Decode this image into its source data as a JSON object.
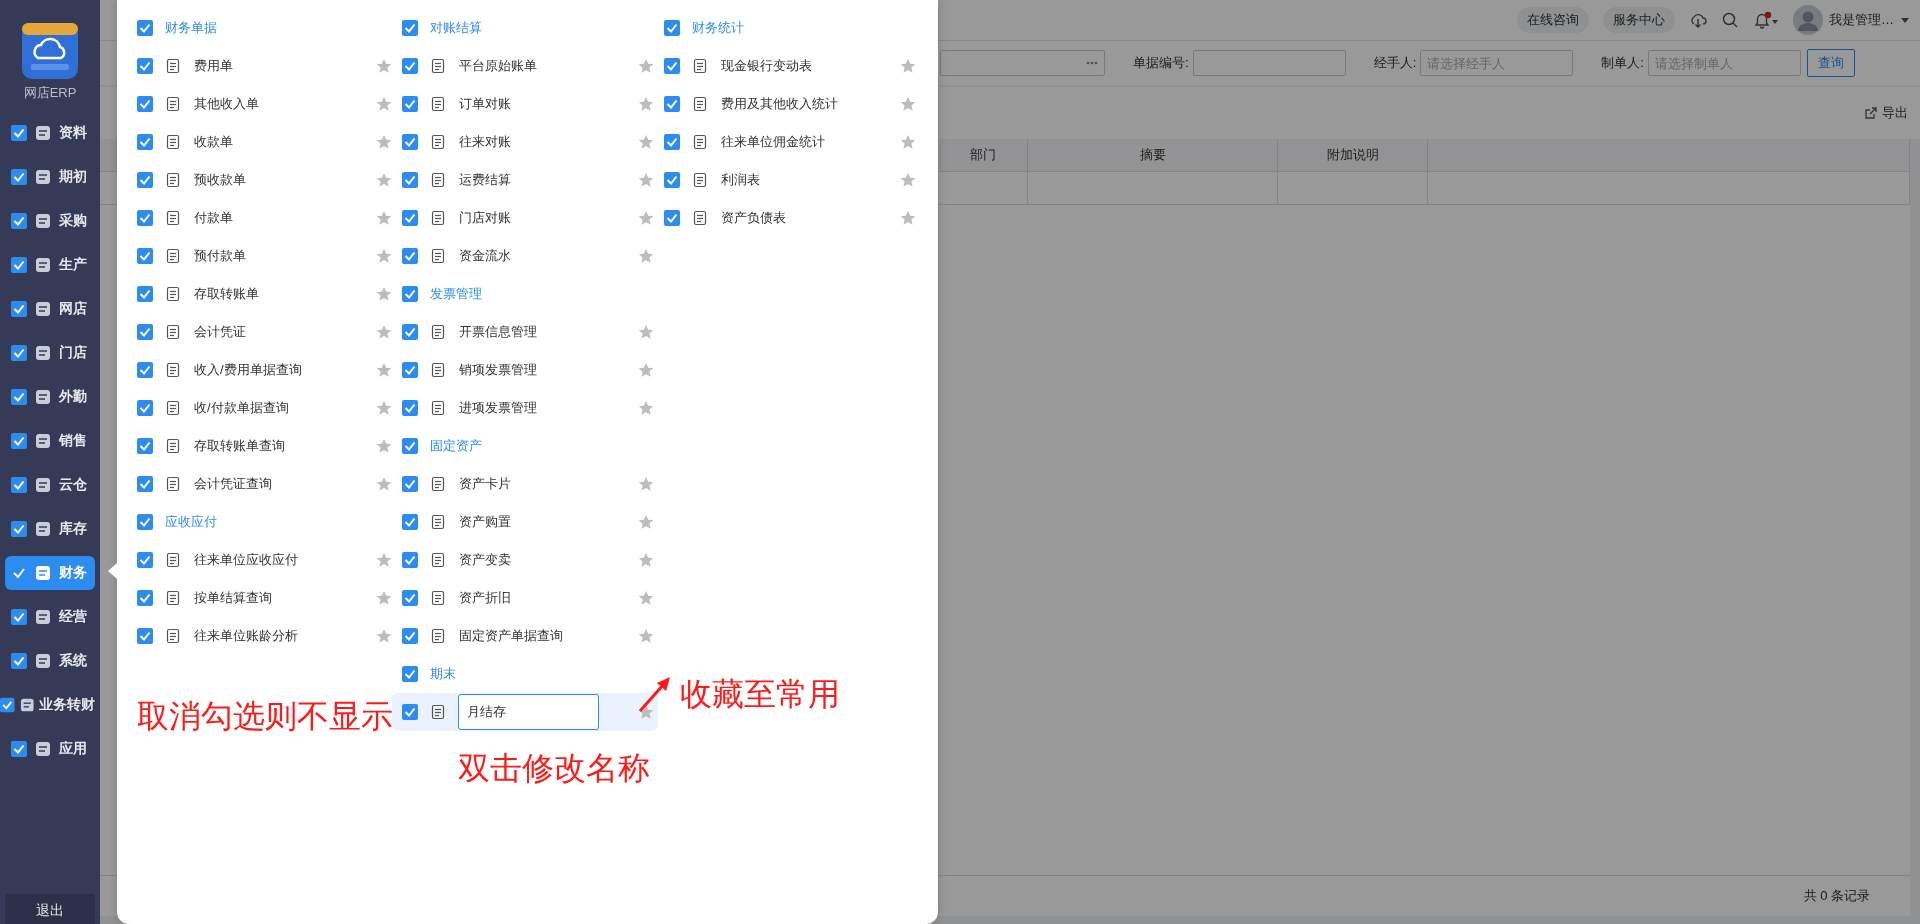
{
  "sidebar": {
    "app_name": "网店ERP",
    "items": [
      {
        "label": "资料",
        "checked": true,
        "selected": false
      },
      {
        "label": "期初",
        "checked": true,
        "selected": false
      },
      {
        "label": "采购",
        "checked": true,
        "selected": false
      },
      {
        "label": "生产",
        "checked": true,
        "selected": false
      },
      {
        "label": "网店",
        "checked": true,
        "selected": false
      },
      {
        "label": "门店",
        "checked": true,
        "selected": false
      },
      {
        "label": "外勤",
        "checked": true,
        "selected": false
      },
      {
        "label": "销售",
        "checked": true,
        "selected": false
      },
      {
        "label": "云仓",
        "checked": true,
        "selected": false
      },
      {
        "label": "库存",
        "checked": true,
        "selected": false
      },
      {
        "label": "财务",
        "checked": true,
        "selected": true
      },
      {
        "label": "经营",
        "checked": true,
        "selected": false
      },
      {
        "label": "系统",
        "checked": true,
        "selected": false
      },
      {
        "label": "业务转财",
        "checked": true,
        "selected": false
      },
      {
        "label": "应用",
        "checked": true,
        "selected": false
      }
    ],
    "logout": "退出"
  },
  "app": {
    "top_links": [
      "在线咨询",
      "服务中心"
    ],
    "has_alert": true,
    "user_name": "我是管理…",
    "filters": [
      {
        "label": "单据编号:"
      },
      {
        "label": "经手人:",
        "placeholder": "请选择经手人"
      },
      {
        "label": "制单人:",
        "placeholder": "请选择制单人"
      }
    ],
    "search_button": "查询",
    "export": "导出",
    "table": {
      "columns": [
        "部门",
        "摘要",
        "附加说明"
      ]
    },
    "footer": "共 0 条记录"
  },
  "menu_panel": {
    "columns": [
      [
        {
          "title": "财务单据",
          "checked": true,
          "items": [
            {
              "label": "费用单",
              "checked": true,
              "favorite": false
            },
            {
              "label": "其他收入单",
              "checked": true,
              "favorite": false
            },
            {
              "label": "收款单",
              "checked": true,
              "favorite": false
            },
            {
              "label": "预收款单",
              "checked": true,
              "favorite": false
            },
            {
              "label": "付款单",
              "checked": true,
              "favorite": false
            },
            {
              "label": "预付款单",
              "checked": true,
              "favorite": false
            },
            {
              "label": "存取转账单",
              "checked": true,
              "favorite": false
            },
            {
              "label": "会计凭证",
              "checked": true,
              "favorite": false
            },
            {
              "label": "收入/费用单据查询",
              "checked": true,
              "favorite": false
            },
            {
              "label": "收/付款单据查询",
              "checked": true,
              "favorite": false
            },
            {
              "label": "存取转账单查询",
              "checked": true,
              "favorite": false
            },
            {
              "label": "会计凭证查询",
              "checked": true,
              "favorite": false
            }
          ]
        },
        {
          "title": "应收应付",
          "checked": true,
          "items": [
            {
              "label": "往来单位应收应付",
              "checked": true,
              "favorite": false
            },
            {
              "label": "按单结算查询",
              "checked": true,
              "favorite": false
            },
            {
              "label": "往来单位账龄分析",
              "checked": true,
              "favorite": false
            }
          ]
        }
      ],
      [
        {
          "title": "对账结算",
          "checked": true,
          "items": [
            {
              "label": "平台原始账单",
              "checked": true,
              "favorite": false
            },
            {
              "label": "订单对账",
              "checked": true,
              "favorite": false
            },
            {
              "label": "往来对账",
              "checked": true,
              "favorite": false
            },
            {
              "label": "运费结算",
              "checked": true,
              "favorite": false
            },
            {
              "label": "门店对账",
              "checked": true,
              "favorite": false
            },
            {
              "label": "资金流水",
              "checked": true,
              "favorite": false
            }
          ]
        },
        {
          "title": "发票管理",
          "checked": true,
          "items": [
            {
              "label": "开票信息管理",
              "checked": true,
              "favorite": false
            },
            {
              "label": "销项发票管理",
              "checked": true,
              "favorite": false
            },
            {
              "label": "进项发票管理",
              "checked": true,
              "favorite": false
            }
          ]
        },
        {
          "title": "固定资产",
          "checked": true,
          "items": [
            {
              "label": "资产卡片",
              "checked": true,
              "favorite": false
            },
            {
              "label": "资产购置",
              "checked": true,
              "favorite": false
            },
            {
              "label": "资产变卖",
              "checked": true,
              "favorite": false
            },
            {
              "label": "资产折旧",
              "checked": true,
              "favorite": false
            },
            {
              "label": "固定资产单据查询",
              "checked": true,
              "favorite": false
            }
          ]
        },
        {
          "title": "期末",
          "checked": true,
          "items": [
            {
              "label": "月结存",
              "checked": true,
              "favorite": false,
              "editing": true
            }
          ]
        }
      ],
      [
        {
          "title": "财务统计",
          "checked": true,
          "items": [
            {
              "label": "现金银行变动表",
              "checked": true,
              "favorite": false
            },
            {
              "label": "费用及其他收入统计",
              "checked": true,
              "favorite": false
            },
            {
              "label": "往来单位佣金统计",
              "checked": true,
              "favorite": false
            },
            {
              "label": "利润表",
              "checked": true,
              "favorite": false
            },
            {
              "label": "资产负债表",
              "checked": true,
              "favorite": false
            }
          ]
        }
      ]
    ]
  },
  "annotations": [
    {
      "text": "取消勾选则不显示"
    },
    {
      "text": "收藏至常用"
    },
    {
      "text": "双击修改名称"
    }
  ]
}
